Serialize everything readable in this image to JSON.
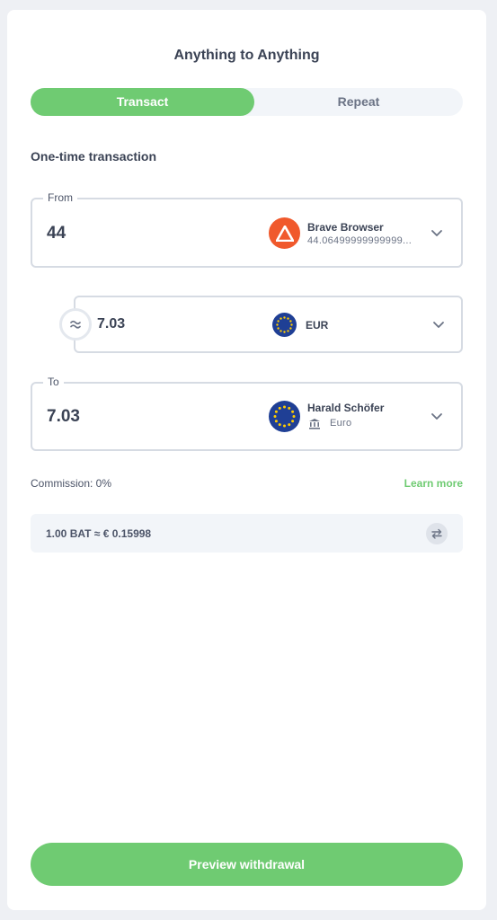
{
  "header": {
    "title": "Anything to Anything"
  },
  "tabs": [
    {
      "label": "Transact",
      "active": true
    },
    {
      "label": "Repeat",
      "active": false
    }
  ],
  "section": {
    "title": "One-time transaction"
  },
  "from": {
    "legend": "From",
    "amount": "44",
    "asset_name": "Brave Browser",
    "asset_sub": "44.06499999999999...",
    "icon": "brave-bat-logo-icon"
  },
  "convert": {
    "amount": "7.03",
    "currency": "EUR",
    "icon": "eu-flag-icon"
  },
  "to": {
    "legend": "To",
    "amount": "7.03",
    "name": "Harald Schöfer",
    "sub": "Euro",
    "icon": "eu-flag-icon",
    "sub_icon": "bank-icon"
  },
  "commission": {
    "label": "Commission: 0%",
    "link": "Learn more"
  },
  "rate": {
    "text": "1.00 BAT ≈ € 0.15998"
  },
  "cta": {
    "label": "Preview withdrawal"
  },
  "colors": {
    "accent": "#6fcb72",
    "bat": "#f0592c",
    "eu": "#1f3f95"
  }
}
